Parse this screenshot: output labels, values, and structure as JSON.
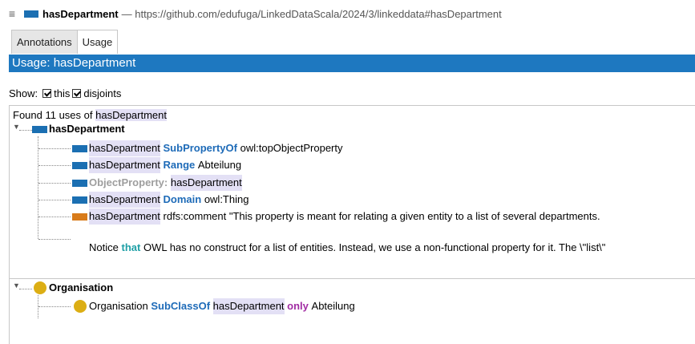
{
  "title": {
    "entity_name": "hasDepartment",
    "iri_text": "— https://github.com/edufuga/LinkedDataScala/2024/3/linkeddata#hasDepartment"
  },
  "tabs": [
    {
      "label": "Annotations"
    },
    {
      "label": "Usage"
    }
  ],
  "usage_header": "Usage: hasDepartment",
  "show": {
    "label": "Show:",
    "this_label": "this",
    "disjoints_label": "disjoints"
  },
  "found": {
    "prefix": "Found 11 uses of",
    "entity": "hasDepartment"
  },
  "groups": [
    {
      "header": "hasDepartment",
      "rows": [
        {
          "subject": "hasDepartment",
          "keyword": "SubPropertyOf",
          "object": "owl:topObjectProperty"
        },
        {
          "subject": "hasDepartment",
          "keyword": "Range",
          "object": "Abteilung"
        },
        {
          "keyword": "ObjectProperty:",
          "object": "hasDepartment"
        },
        {
          "subject": "hasDepartment",
          "keyword": "Domain",
          "object": "owl:Thing"
        },
        {
          "subject": "hasDepartment",
          "rest": "rdfs:comment \"This property is meant for relating a given entity to a list of several departments."
        }
      ],
      "comment_line2": {
        "before": "Notice",
        "keyword": "that",
        "after": "OWL has no construct for a list of entities. Instead, we use a non-functional property for it. The \\\"list\\\""
      }
    },
    {
      "header": "Organisation",
      "rows": [
        {
          "subject": "Organisation",
          "keyword1": "SubClassOf",
          "middle": "hasDepartment",
          "keyword2": "only",
          "object": "Abteilung"
        }
      ]
    }
  ]
}
